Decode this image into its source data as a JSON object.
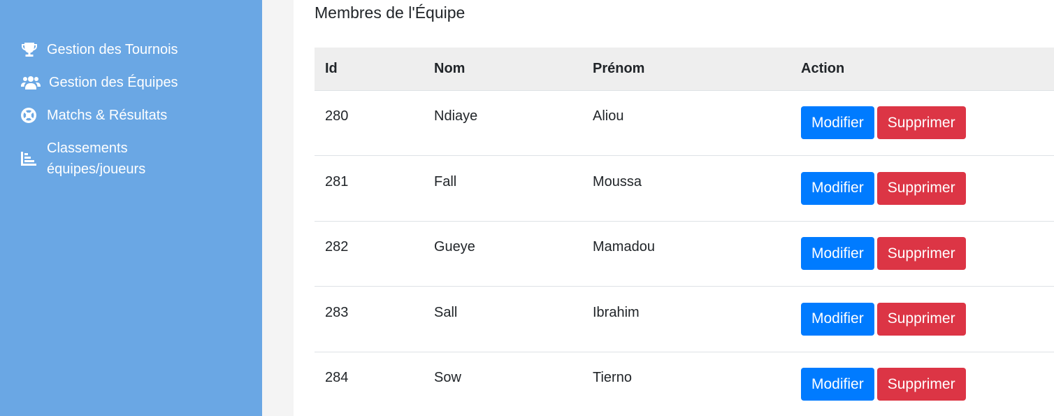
{
  "sidebar": {
    "items": [
      {
        "label": "Gestion des Tournois",
        "icon": "trophy-icon"
      },
      {
        "label": "Gestion des Équipes",
        "icon": "users-icon"
      },
      {
        "label": "Matchs & Résultats",
        "icon": "life-ring-icon"
      },
      {
        "label": "Classements équipes/joueurs",
        "icon": "chart-bar-icon"
      }
    ]
  },
  "main": {
    "title": "Membres de l'Équipe",
    "table": {
      "headers": [
        "Id",
        "Nom",
        "Prénom",
        "Action"
      ],
      "rows": [
        {
          "id": "280",
          "nom": "Ndiaye",
          "prenom": "Aliou"
        },
        {
          "id": "281",
          "nom": "Fall",
          "prenom": "Moussa"
        },
        {
          "id": "282",
          "nom": "Gueye",
          "prenom": "Mamadou"
        },
        {
          "id": "283",
          "nom": "Sall",
          "prenom": "Ibrahim"
        },
        {
          "id": "284",
          "nom": "Sow",
          "prenom": "Tierno"
        }
      ],
      "modifier_label": "Modifier",
      "supprimer_label": "Supprimer"
    }
  },
  "colors": {
    "sidebar_bg": "#6aa7e4",
    "primary": "#007bff",
    "danger": "#dc3545"
  }
}
